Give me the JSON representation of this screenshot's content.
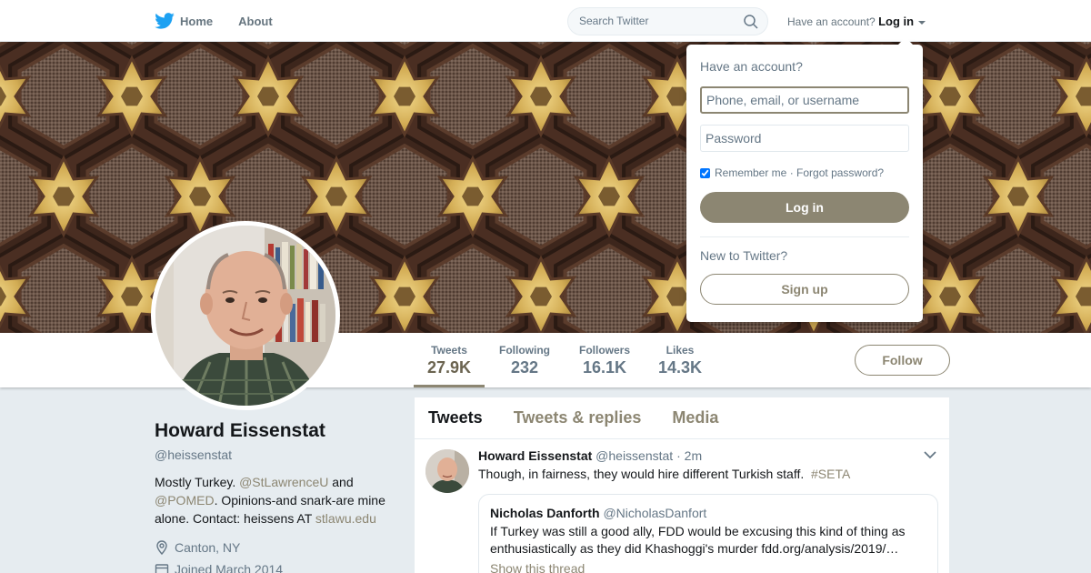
{
  "nav": {
    "home_label": "Home",
    "about_label": "About",
    "search_placeholder": "Search Twitter",
    "have_account_label": "Have an account?",
    "login_label": "Log in"
  },
  "icons": {
    "logo": "twitter-bird-icon",
    "search": "search-icon",
    "location": "location-pin-icon",
    "calendar": "calendar-icon",
    "tweet_menu": "chevron-down-icon"
  },
  "colors": {
    "accent": "#8c8672",
    "twitter_blue": "#1da1f2"
  },
  "profile": {
    "name": "Howard Eissenstat",
    "handle": "@heissenstat",
    "bio": {
      "part1": "Mostly Turkey. ",
      "mention1": "@StLawrenceU",
      "part2": " and ",
      "mention2": "@POMED",
      "part3": ". Opinions-and snark-are mine alone. Contact: heissens AT ",
      "link": "stlawu.edu"
    },
    "location": "Canton, NY",
    "joined": "Joined March 2014"
  },
  "stats": [
    {
      "label": "Tweets",
      "value": "27.9K"
    },
    {
      "label": "Following",
      "value": "232"
    },
    {
      "label": "Followers",
      "value": "16.1K"
    },
    {
      "label": "Likes",
      "value": "14.3K"
    }
  ],
  "follow_label": "Follow",
  "timeline": {
    "tabs": [
      "Tweets",
      "Tweets & replies",
      "Media"
    ],
    "tweet": {
      "author_name": "Howard Eissenstat",
      "author_handle": "@heissenstat",
      "separator": "·",
      "time": "2m",
      "text": "Though, in fairness, they would hire different Turkish staff.",
      "hashtag": "#SETA",
      "quote": {
        "author_name": "Nicholas Danforth",
        "author_handle": "@NicholasDanfort",
        "text": "If Turkey was still a good ally, FDD would be excusing this kind of thing as enthusiastically as they did Khashoggi's murder fdd.org/analysis/2019/…",
        "more": "Show this thread"
      }
    }
  },
  "login_dropdown": {
    "title": "Have an account?",
    "username_placeholder": "Phone, email, or username",
    "password_placeholder": "Password",
    "remember_label": "Remember me",
    "separator": "·",
    "forgot_label": "Forgot password?",
    "login_button": "Log in",
    "new_label": "New to Twitter?",
    "signup_button": "Sign up"
  }
}
